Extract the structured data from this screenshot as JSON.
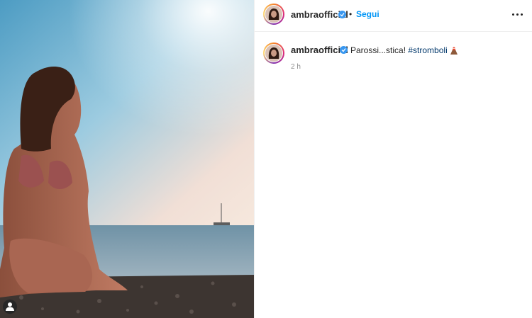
{
  "post": {
    "photo_alt": "Woman sitting on a pebble beach by the sea",
    "header": {
      "username": "ambraofficial",
      "separator": "•",
      "follow_label": "Segui",
      "more_icon": "more-options-icon"
    },
    "caption": {
      "username": "ambraofficial",
      "text": "Parossi...stica!",
      "hashtag": "#stromboli",
      "emoji": "volcano-emoji"
    },
    "timestamp": "2 h"
  },
  "colors": {
    "accent": "#0095f6",
    "verified": "#3897f0",
    "hashtag": "#00376b",
    "muted": "#8e8e8e"
  }
}
